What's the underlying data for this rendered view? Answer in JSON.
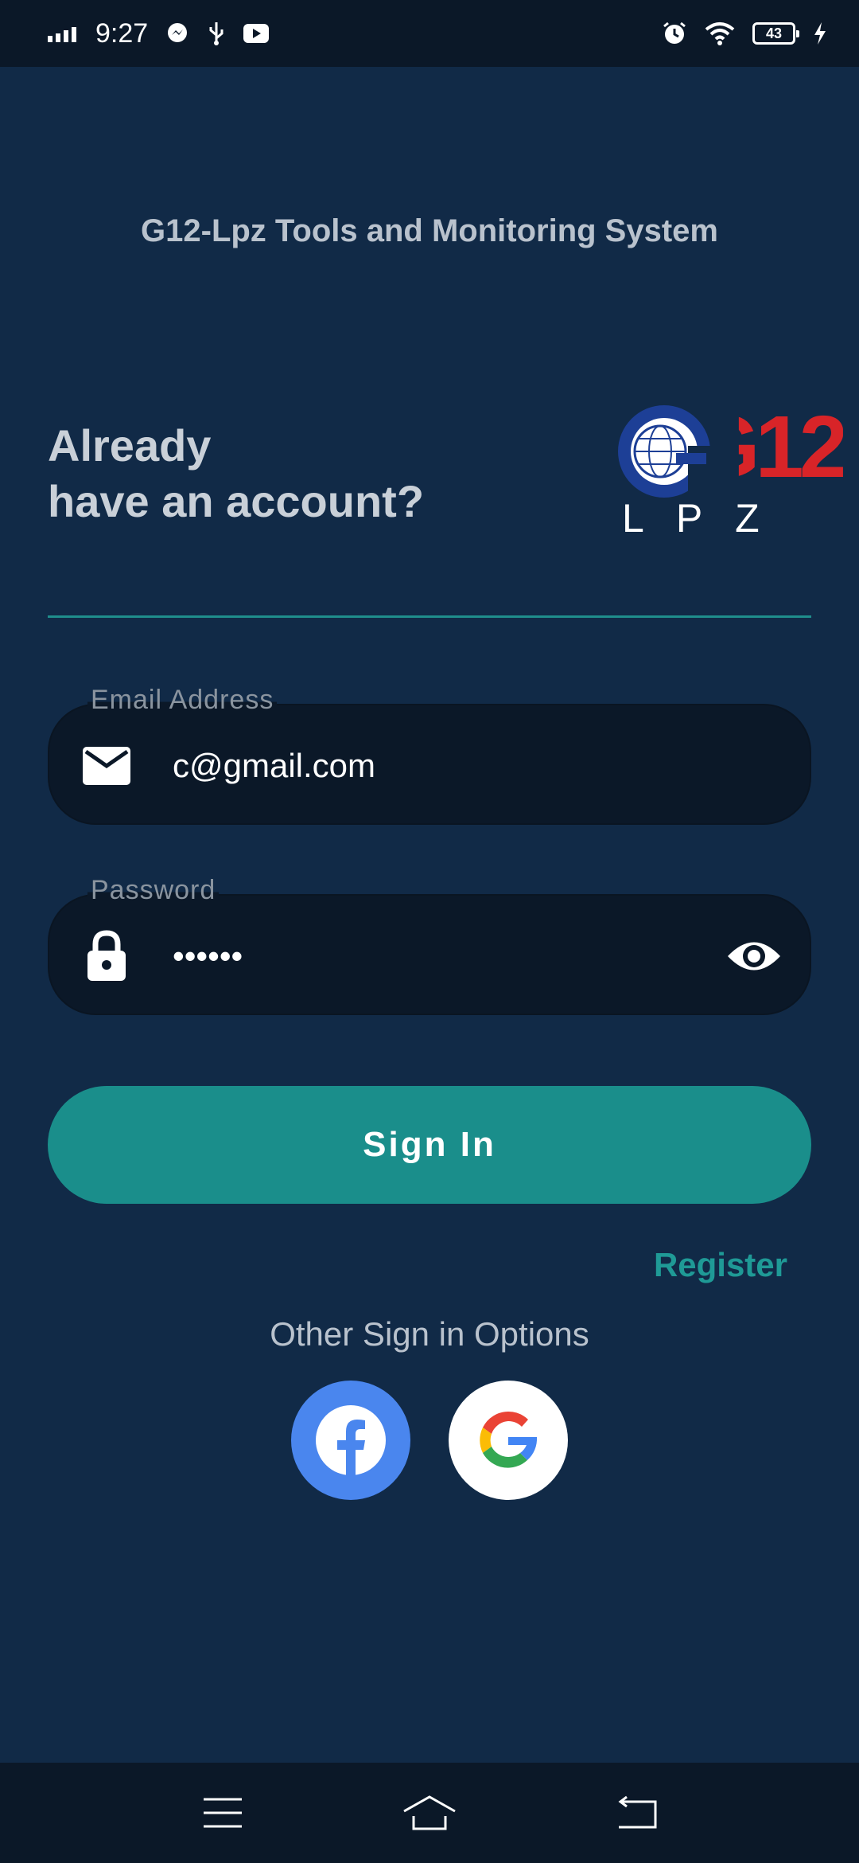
{
  "status_bar": {
    "time": "9:27",
    "battery": "43",
    "icons_left": [
      "signal-icon",
      "messenger-icon",
      "usb-icon",
      "youtube-icon"
    ],
    "icons_right": [
      "alarm-icon",
      "wifi-icon",
      "battery-icon",
      "charging-icon"
    ]
  },
  "app": {
    "title": "G12-Lpz Tools and Monitoring System",
    "heading_line1": "Already",
    "heading_line2": "have an account?",
    "logo_text_top": "G12",
    "logo_text_bottom": "L P Z"
  },
  "form": {
    "email": {
      "label": "Email Address",
      "value": "c@gmail.com"
    },
    "password": {
      "label": "Password",
      "value": "••••••"
    },
    "signin_label": "Sign In",
    "register_label": "Register",
    "other_options_label": "Other Sign in Options"
  },
  "colors": {
    "background": "#112a47",
    "field_bg": "#0b1828",
    "accent": "#1a8e8b",
    "facebook": "#4a86ee"
  },
  "social": [
    "facebook-icon",
    "google-icon"
  ],
  "nav": [
    "menu-icon",
    "home-icon",
    "back-icon"
  ]
}
